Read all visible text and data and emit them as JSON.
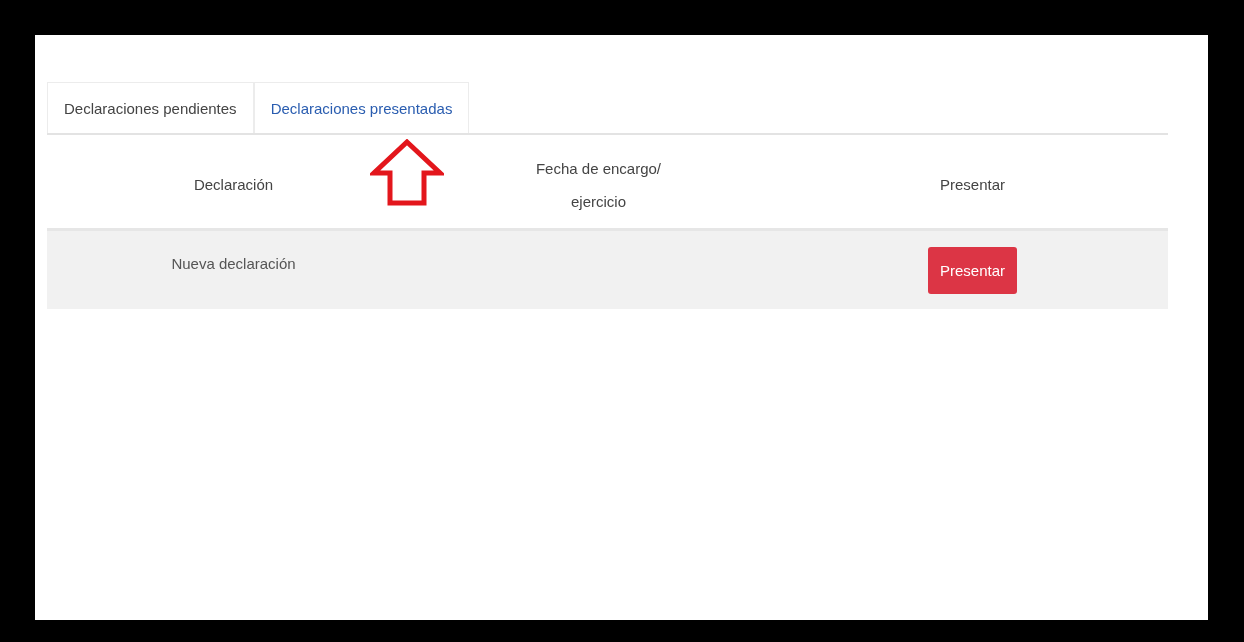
{
  "tabs": [
    {
      "label": "Declaraciones pendientes",
      "selected": true
    },
    {
      "label": "Declaraciones presentadas",
      "selected": false
    }
  ],
  "table": {
    "columns": [
      "Declaración",
      "Fecha de encargo/\nejercicio",
      "Presentar"
    ],
    "rows": [
      {
        "declaracion": "Nueva declaración",
        "fecha": "",
        "action": "Presentar"
      }
    ]
  }
}
